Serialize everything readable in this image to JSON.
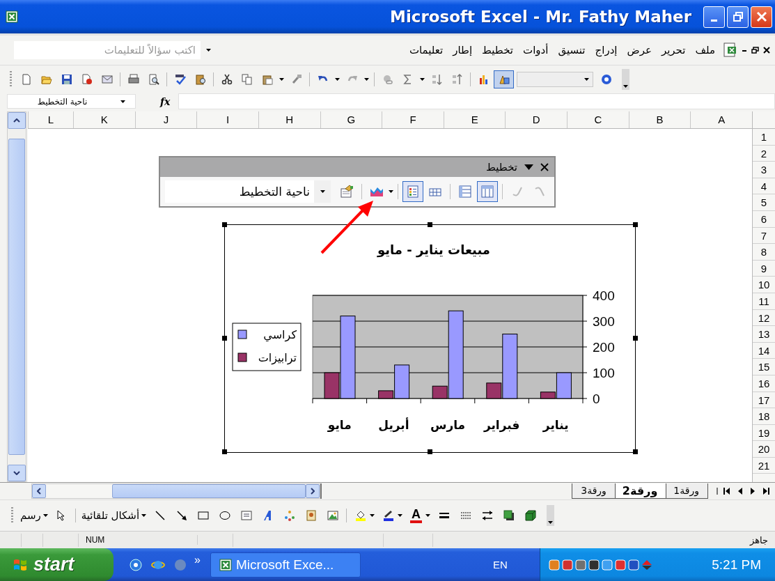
{
  "window": {
    "title": "Microsoft Excel - Mr. Fathy Maher"
  },
  "menu": {
    "items": [
      "ملف",
      "تحرير",
      "عرض",
      "إدراج",
      "تنسيق",
      "أدوات",
      "تخطيط",
      "إطار",
      "تعليمات"
    ],
    "help_box": {
      "placeholder": "اكتب سؤالاً للتعليمات"
    }
  },
  "standard_toolbar": {
    "drawing_pressed": true
  },
  "formula_bar": {
    "name_box": "ناحية التخطيط",
    "fx": "fx"
  },
  "sheet": {
    "columns": [
      "A",
      "B",
      "C",
      "D",
      "E",
      "F",
      "G",
      "H",
      "I",
      "J",
      "K",
      "L"
    ],
    "rows": [
      "1",
      "2",
      "3",
      "4",
      "5",
      "6",
      "7",
      "8",
      "9",
      "10",
      "11",
      "12",
      "13",
      "14",
      "15",
      "16",
      "17",
      "18",
      "19",
      "20",
      "21"
    ]
  },
  "chart_toolbar": {
    "title": "تخطيط",
    "chart_area": "ناحية التخطيط",
    "legend_pressed": true,
    "data_table_pressed": false,
    "by_row_pressed": false,
    "by_column_pressed": true
  },
  "chart": {
    "chart_data": {
      "type": "bar",
      "title": "مبيعات يناير - مايو",
      "categories": [
        "مايو",
        "أبريل",
        "مارس",
        "فبراير",
        "يناير"
      ],
      "series": [
        {
          "name": "كراسي",
          "color": "#9999ff",
          "values": [
            320,
            130,
            340,
            250,
            100
          ]
        },
        {
          "name": "ترابيزات",
          "color": "#993366",
          "values": [
            100,
            30,
            48,
            60,
            25
          ]
        }
      ],
      "ylim": [
        0,
        400
      ],
      "yticks": [
        0,
        100,
        200,
        300,
        400
      ],
      "grid": true,
      "legend": true
    }
  },
  "sheet_tabs": [
    {
      "label": "ورقة1",
      "selected": false
    },
    {
      "label": "ورقة2",
      "selected": true
    },
    {
      "label": "ورقة3",
      "selected": false
    }
  ],
  "drawing_toolbar": {
    "draw_menu": "رسم",
    "autoshapes": "أشكال تلقائية",
    "font_color_glyph": "A"
  },
  "status_bar": {
    "status": "جاهز",
    "indicator": "NUM"
  },
  "taskbar": {
    "start": "start",
    "overflow": "»",
    "task": "Microsoft Exce...",
    "language": "EN",
    "clock": "5:21 PM"
  }
}
